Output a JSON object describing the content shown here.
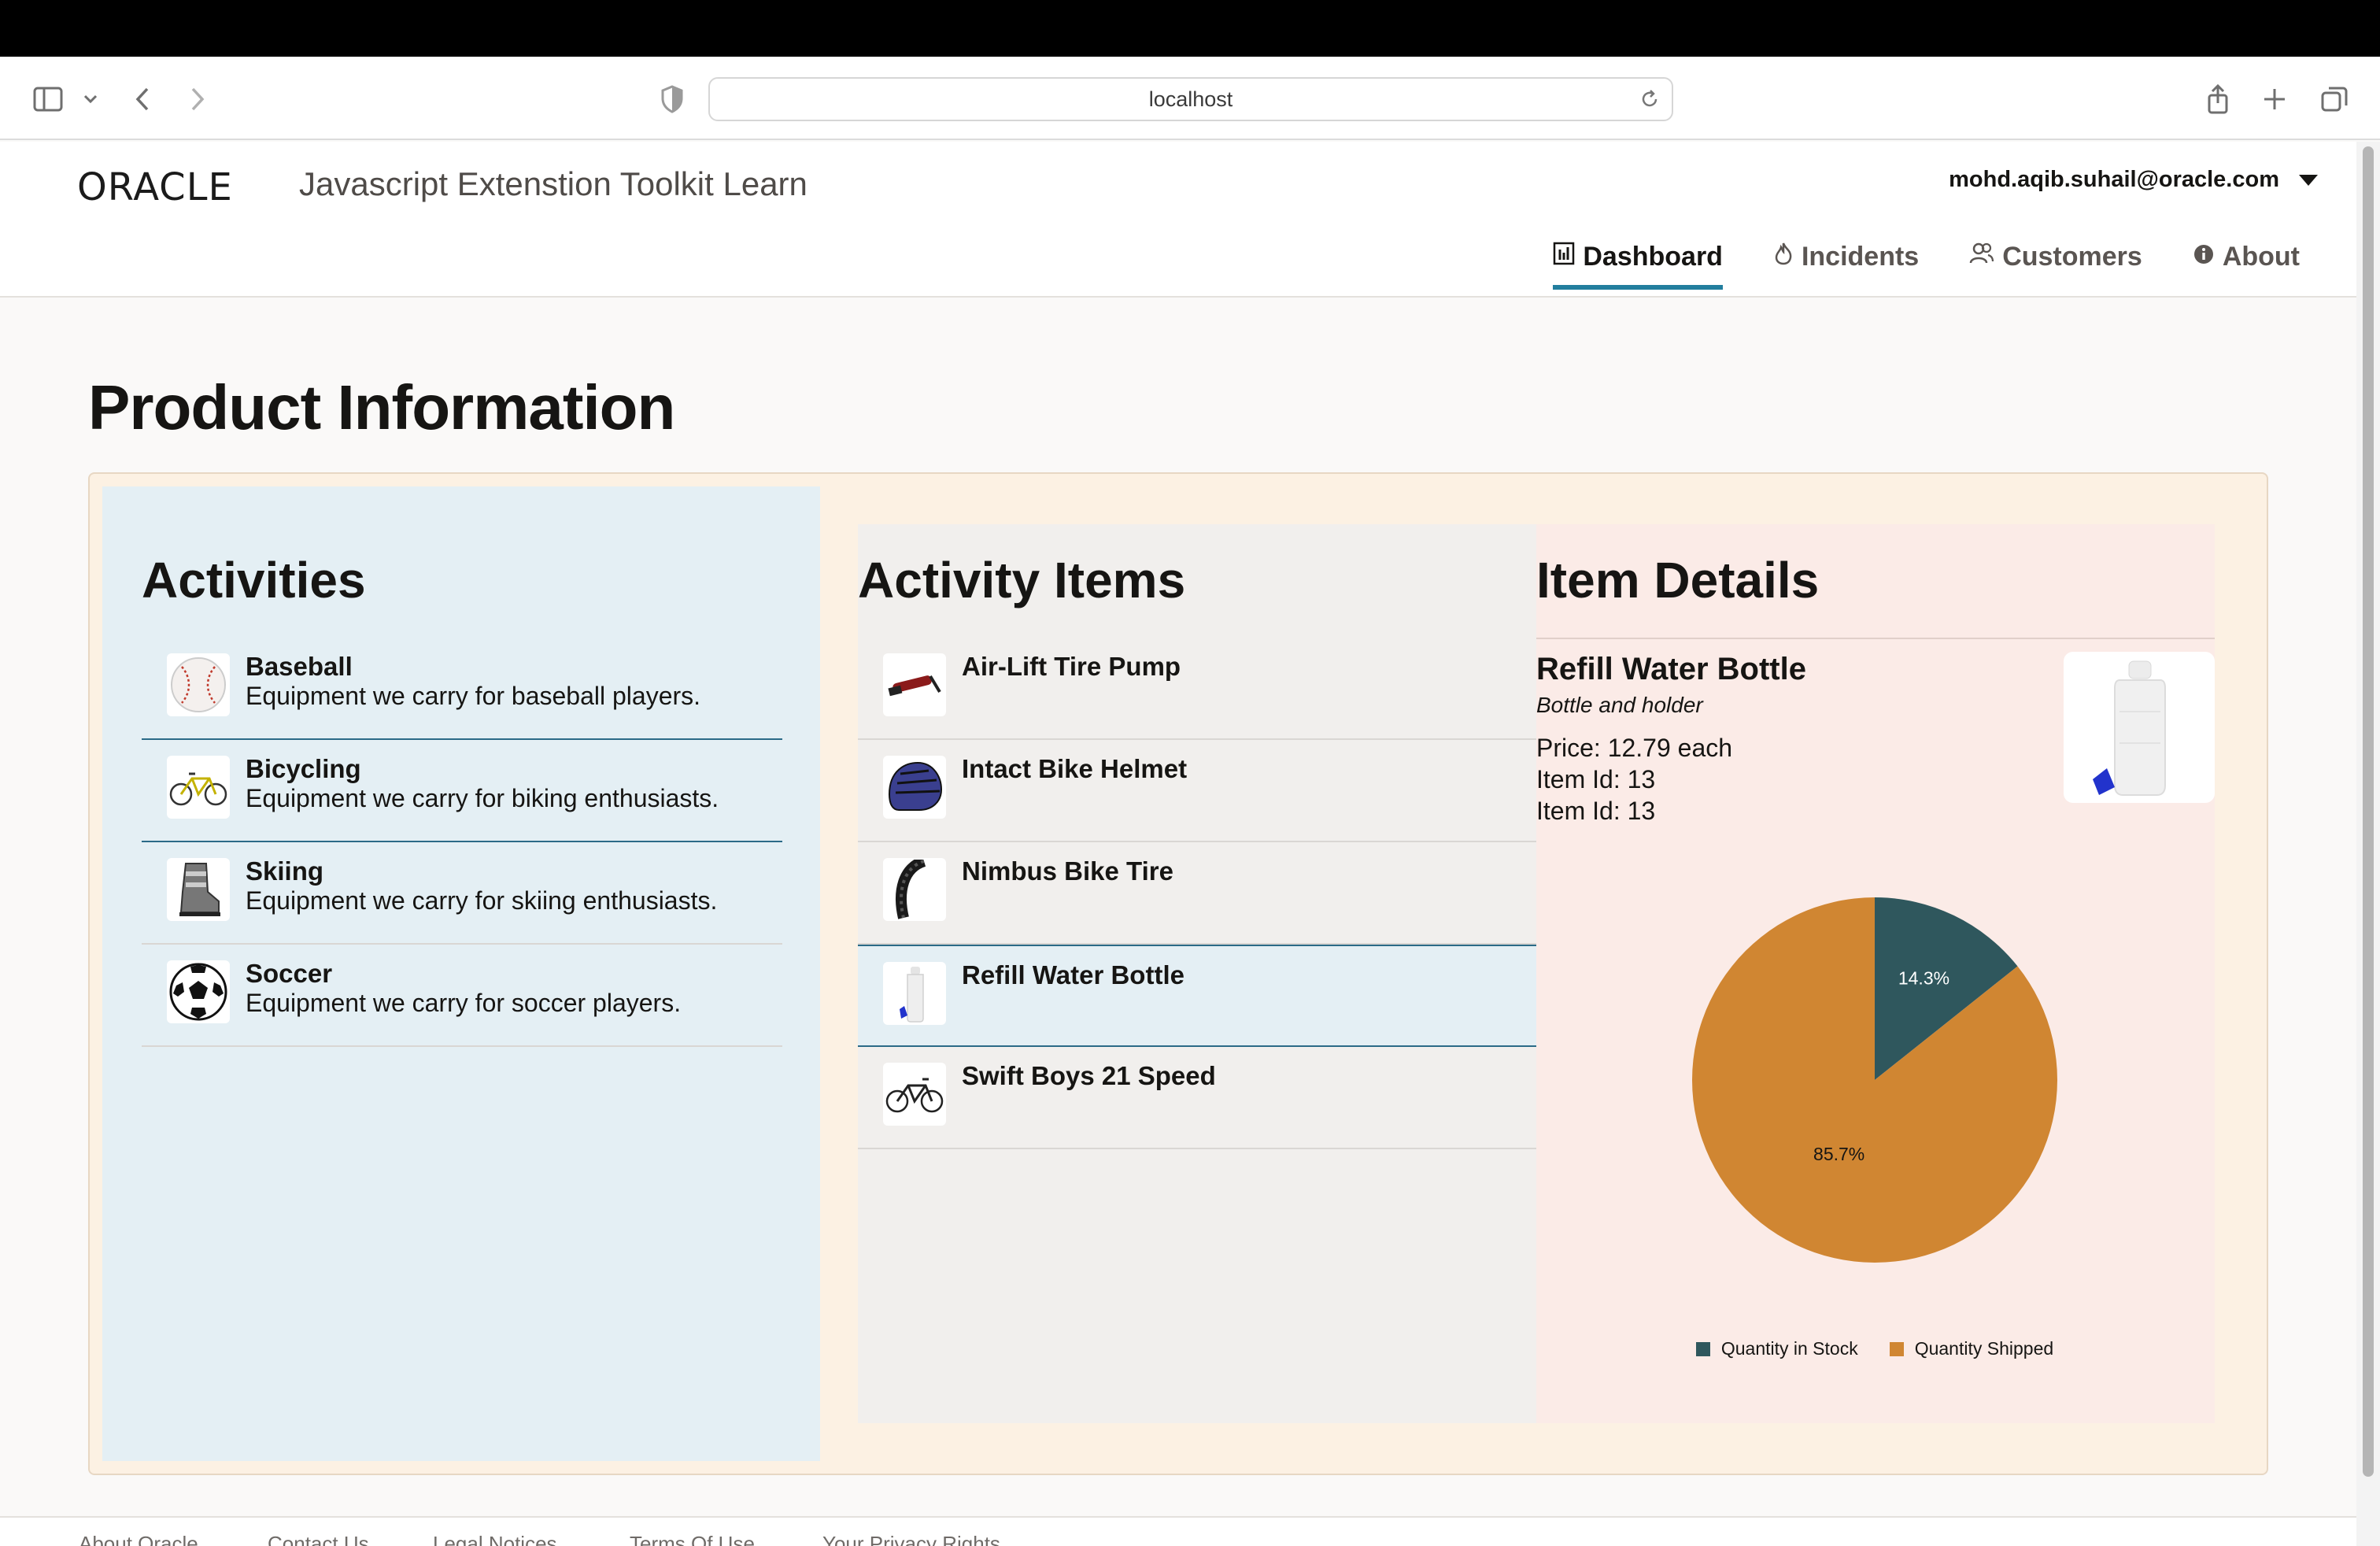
{
  "browser": {
    "url": "localhost"
  },
  "header": {
    "logo": "ORACLE",
    "title": "Javascript Extenstion Toolkit Learn",
    "user": "mohd.aqib.suhail@oracle.com"
  },
  "nav": {
    "tabs": [
      {
        "label": "Dashboard",
        "icon": "chart-icon",
        "active": true
      },
      {
        "label": "Incidents",
        "icon": "fire-icon",
        "active": false
      },
      {
        "label": "Customers",
        "icon": "people-icon",
        "active": false
      },
      {
        "label": "About",
        "icon": "info-icon",
        "active": false
      }
    ]
  },
  "page": {
    "title": "Product Information"
  },
  "activities": {
    "heading": "Activities",
    "items": [
      {
        "name": "Baseball",
        "desc": "Equipment we carry for baseball players.",
        "icon": "baseball-icon"
      },
      {
        "name": "Bicycling",
        "desc": "Equipment we carry for biking enthusiasts.",
        "icon": "bicycle-icon"
      },
      {
        "name": "Skiing",
        "desc": "Equipment we carry for skiing enthusiasts.",
        "icon": "ski-boot-icon"
      },
      {
        "name": "Soccer",
        "desc": "Equipment we carry for soccer players.",
        "icon": "soccer-ball-icon"
      }
    ]
  },
  "activity_items": {
    "heading": "Activity Items",
    "items": [
      {
        "name": "Air-Lift Tire Pump",
        "icon": "tire-pump-icon",
        "selected": false
      },
      {
        "name": "Intact Bike Helmet",
        "icon": "helmet-icon",
        "selected": false
      },
      {
        "name": "Nimbus Bike Tire",
        "icon": "tire-icon",
        "selected": false
      },
      {
        "name": "Refill Water Bottle",
        "icon": "water-bottle-icon",
        "selected": true
      },
      {
        "name": "Swift Boys 21 Speed",
        "icon": "bicycle-icon",
        "selected": false
      }
    ]
  },
  "item_details": {
    "heading": "Item Details",
    "name": "Refill Water Bottle",
    "desc": "Bottle and holder",
    "price": "Price: 12.79 each",
    "item_id_1": "Item Id: 13",
    "item_id_2": "Item Id: 13",
    "image_icon": "water-bottle-icon"
  },
  "chart_data": {
    "type": "pie",
    "series": [
      {
        "name": "Quantity in Stock",
        "value": 14.3,
        "label": "14.3%",
        "color": "#2f575d"
      },
      {
        "name": "Quantity Shipped",
        "value": 85.7,
        "label": "85.7%",
        "color": "#d08632"
      }
    ],
    "legend_position": "bottom"
  },
  "footer": {
    "links": [
      "About Oracle",
      "Contact Us",
      "Legal Notices",
      "Terms Of Use",
      "Your Privacy Rights"
    ]
  }
}
